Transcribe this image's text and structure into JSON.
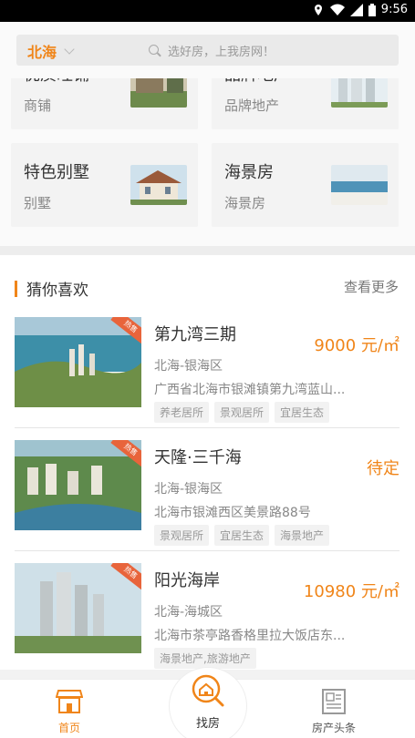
{
  "status_bar": {
    "time": "9:56"
  },
  "search": {
    "city": "北海",
    "placeholder": "选好房，上我房网！"
  },
  "categories": [
    {
      "title": "优质旺铺",
      "subtitle": "商铺",
      "image": "shops-photo"
    },
    {
      "title": "品牌地产",
      "subtitle": "品牌地产",
      "image": "brand-towers-photo"
    },
    {
      "title": "特色别墅",
      "subtitle": "别墅",
      "image": "villa-photo"
    },
    {
      "title": "海景房",
      "subtitle": "海景房",
      "image": "seaview-photo"
    }
  ],
  "likes": {
    "title": "猜你喜欢",
    "more": "查看更多",
    "items": [
      {
        "name": "第九湾三期",
        "area": "北海-银海区",
        "address": "广西省北海市银滩镇第九湾蓝山...",
        "price_num": "9000",
        "price_unit": "元/㎡",
        "tags": [
          "养老居所",
          "景观居所",
          "宜居生态"
        ],
        "badge": "热售"
      },
      {
        "name": "天隆·三千海",
        "area": "北海-银海区",
        "address": "北海市银滩西区美景路88号",
        "price_num": "待定",
        "price_unit": "",
        "tags": [
          "景观居所",
          "宜居生态",
          "海景地产"
        ],
        "badge": "热售"
      },
      {
        "name": "阳光海岸",
        "area": "北海-海城区",
        "address": "北海市茶亭路香格里拉大饭店东...",
        "price_num": "10980",
        "price_unit": "元/㎡",
        "tags": [
          "海景地产,旅游地产"
        ],
        "badge": "热售"
      }
    ]
  },
  "tabbar": {
    "home": "首页",
    "find": "找房",
    "news": "房产头条"
  },
  "colors": {
    "accent": "#f08519",
    "background": "#f2f2f2"
  }
}
